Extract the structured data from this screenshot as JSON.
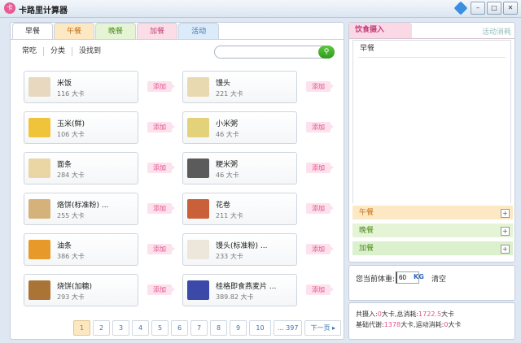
{
  "window": {
    "title": "卡路里计算器",
    "app_icon": "卡"
  },
  "tabs": [
    "早餐",
    "午餐",
    "晚餐",
    "加餐",
    "活动"
  ],
  "filters": [
    "常吃",
    "分类",
    "没找到"
  ],
  "search": {
    "placeholder": "",
    "button_icon": "search-icon"
  },
  "add_label": "添加",
  "foods": [
    {
      "name": "米饭",
      "cal": "116 大卡",
      "thumb": "#e8d8c0"
    },
    {
      "name": "馒头",
      "cal": "221 大卡",
      "thumb": "#e9d9b0"
    },
    {
      "name": "玉米(鲜)",
      "cal": "106 大卡",
      "thumb": "#f0c43a"
    },
    {
      "name": "小米粥",
      "cal": "46 大卡",
      "thumb": "#e3d27a"
    },
    {
      "name": "面条",
      "cal": "284 大卡",
      "thumb": "#e9d6a4"
    },
    {
      "name": "粳米粥",
      "cal": "46 大卡",
      "thumb": "#5b5b5b"
    },
    {
      "name": "烙饼(标准粉) ...",
      "cal": "255 大卡",
      "thumb": "#d4b27a"
    },
    {
      "name": "花卷",
      "cal": "211 大卡",
      "thumb": "#c9603a"
    },
    {
      "name": "油条",
      "cal": "386 大卡",
      "thumb": "#e79a2a"
    },
    {
      "name": "馒头(标准粉) ...",
      "cal": "233 大卡",
      "thumb": "#ede6da"
    },
    {
      "name": "烧饼(加糖)",
      "cal": "293 大卡",
      "thumb": "#a97436"
    },
    {
      "name": "桂格即食燕麦片 ...",
      "cal": "389.82 大卡",
      "thumb": "#3b4aa8"
    }
  ],
  "pagination": {
    "pages": [
      "1",
      "2",
      "3",
      "4",
      "5",
      "6",
      "7",
      "8",
      "9",
      "10",
      "... 397"
    ],
    "current": "1",
    "next": "下一页"
  },
  "right_panel": {
    "tab_active": "饮食摄入",
    "tab_inactive": "活动消耗",
    "list_header": "早餐",
    "meals": [
      "午餐",
      "晚餐",
      "加餐"
    ]
  },
  "weight": {
    "label": "您当前体重:",
    "value": "60",
    "unit": "KG",
    "clear": "清空"
  },
  "summary": {
    "intake_label": "共摄入:",
    "intake_value": "0",
    "intake_unit": "大卡,总消耗:",
    "total_burn": "1722.5",
    "total_unit": "大卡",
    "bmr_label": "基础代谢:",
    "bmr_value": "1378",
    "bmr_unit": "大卡,运动消耗:",
    "exercise_value": "0",
    "exercise_unit": "大卡"
  }
}
